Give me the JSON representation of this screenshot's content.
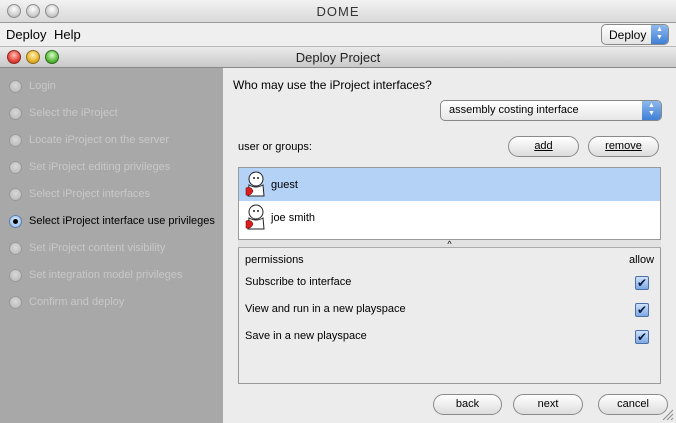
{
  "outer_window": {
    "title": "DOME"
  },
  "menu": {
    "items": [
      "Deploy",
      "Help"
    ],
    "mode_select": "Deploy"
  },
  "dialog": {
    "title": "Deploy Project"
  },
  "steps": [
    {
      "label": "Login",
      "active": false
    },
    {
      "label": "Select the iProject",
      "active": false
    },
    {
      "label": "Locate iProject on the server",
      "active": false
    },
    {
      "label": "Set iProject editing privileges",
      "active": false
    },
    {
      "label": "Select iProject interfaces",
      "active": false
    },
    {
      "label": "Select iProject interface use privileges",
      "active": true
    },
    {
      "label": "Set iProject content visibility",
      "active": false
    },
    {
      "label": "Set integration model privileges",
      "active": false
    },
    {
      "label": "Confirm and deploy",
      "active": false
    }
  ],
  "content": {
    "question": "Who may use the iProject interfaces?",
    "interface_select": "assembly costing interface",
    "users_label": "user or groups:",
    "add_button": "add",
    "remove_button": "remove",
    "users": [
      {
        "name": "guest",
        "selected": true
      },
      {
        "name": "joe smith",
        "selected": false
      }
    ],
    "permissions": {
      "header": "permissions",
      "allow_header": "allow",
      "rows": [
        {
          "label": "Subscribe to interface",
          "allowed": true
        },
        {
          "label": "View and run in a new playspace",
          "allowed": true
        },
        {
          "label": "Save in a new playspace",
          "allowed": true
        }
      ]
    }
  },
  "footer": {
    "back": "back",
    "next": "next",
    "cancel": "cancel"
  },
  "colors": {
    "selection": "#b4d1f6",
    "step_panel": "#a8a8a8",
    "accent": "#3f7fd6"
  }
}
